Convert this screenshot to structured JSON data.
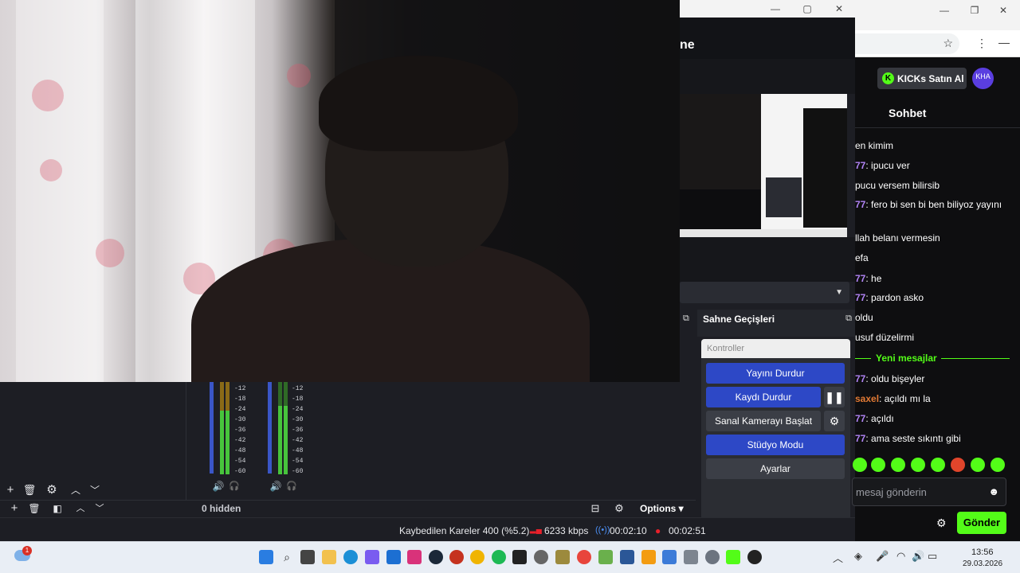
{
  "obs": {
    "partial_title": "ne",
    "transitions_title": "Sahne Geçişleri",
    "controls_title": "Kontroller",
    "controls": {
      "stop_stream": "Yayını Durdur",
      "stop_record": "Kaydı Durdur",
      "start_virtual_cam": "Sanal Kamerayı Başlat",
      "studio_mode": "Stüdyo Modu",
      "settings": "Ayarlar"
    },
    "meter_levels": [
      "-12",
      "-18",
      "-24",
      "-30",
      "-36",
      "-42",
      "-48",
      "-54",
      "-60"
    ],
    "hidden_label": "0 hidden",
    "options_label": "Options",
    "status": {
      "dropped_frames": "Kaybedilen Kareler 400 (%5.2)",
      "bitrate": "6233 kbps",
      "stream_time": "00:02:10",
      "record_time": "00:02:51"
    }
  },
  "browser": {
    "kicks_button": "KICKs Satın Al",
    "avatar_initials": "KHA",
    "chat_title": "Sohbet",
    "messages": [
      {
        "user": "",
        "text": "en kimim"
      },
      {
        "user": "77",
        "text": ": ipucu ver"
      },
      {
        "user": "",
        "text": "pucu versem bilirsib"
      },
      {
        "user": "77",
        "text": ": fero bi sen bi ben biliyoz yayını"
      },
      {
        "user": "",
        "text": "llah belanı vermesin"
      },
      {
        "user": "",
        "text": "efa"
      },
      {
        "user": "77",
        "text": ": he"
      },
      {
        "user": "77",
        "text": ": pardon asko"
      },
      {
        "user": "",
        "text": "oldu"
      },
      {
        "user": "",
        "text": "usuf düzelirmi"
      }
    ],
    "new_messages_label": "Yeni mesajlar",
    "new_messages": [
      {
        "user": "77",
        "text": ": oldu bişeyler",
        "color": "purple"
      },
      {
        "user": "saxel",
        "text": ": açıldı mı la",
        "color": "orange"
      },
      {
        "user": "77",
        "text": ": açıldı",
        "color": "purple"
      },
      {
        "user": "77",
        "text": ": ama seste sıkıntı gibi",
        "color": "purple"
      }
    ],
    "input_placeholder": "mesaj gönderin",
    "send_label": "Gönder"
  },
  "taskbar": {
    "notification_count": "1",
    "time": "13:56",
    "date": "29.03.2026"
  },
  "colors": {
    "kick_green": "#53fc18",
    "obs_blue": "#2d48c6",
    "record_red": "#e8202a"
  }
}
